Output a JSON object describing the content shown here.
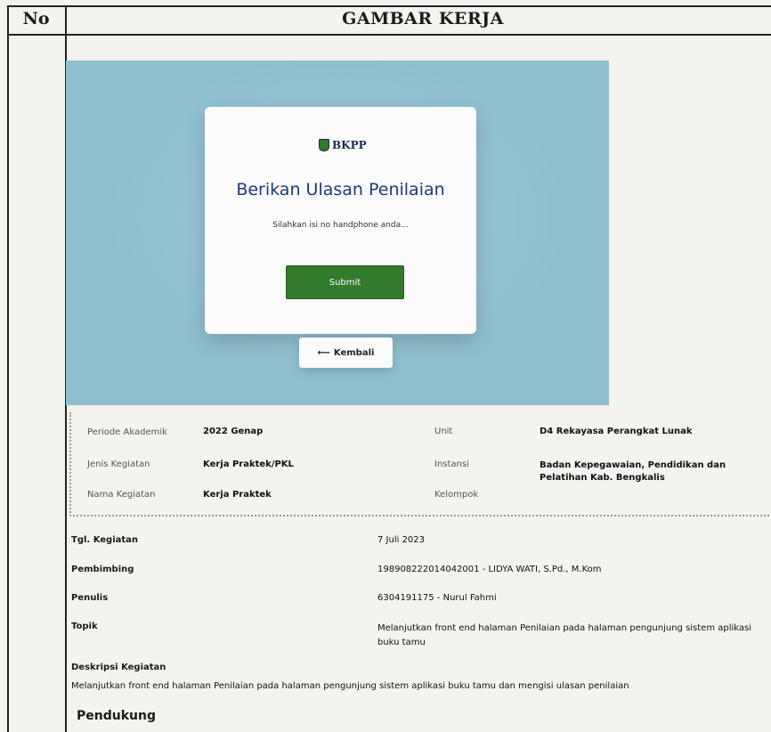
{
  "table": {
    "no_header": "No",
    "title_header": "GAMBAR KERJA"
  },
  "screenshot": {
    "logo_text": "BKPP",
    "card_title": "Berikan Ulasan Penilaian",
    "phone_placeholder": "Silahkan isi no handphone anda...",
    "submit_label": "Submit",
    "back_label": "Kembali"
  },
  "info": {
    "periode_label": "Periode Akademik",
    "periode_value": "2022 Genap",
    "unit_label": "Unit",
    "unit_value": "D4 Rekayasa Perangkat Lunak",
    "jenis_label": "Jenis Kegiatan",
    "jenis_value": "Kerja Praktek/PKL",
    "instansi_label": "Instansi",
    "instansi_value": "Badan Kepegawaian, Pendidikan dan Pelatihan Kab. Bengkalis",
    "nama_label": "Nama Kegiatan",
    "nama_value": "Kerja Praktek",
    "kelompok_label": "Kelompok"
  },
  "details": {
    "tgl_label": "Tgl. Kegiatan",
    "tgl_value": "7 Juli 2023",
    "pembimbing_label": "Pembimbing",
    "pembimbing_value": "198908222014042001 - LIDYA WATI, S.Pd., M.Kom",
    "penulis_label": "Penulis",
    "penulis_value": "6304191175 - Nurul Fahmi",
    "topik_label": "Topik",
    "topik_value": "Melanjutkan front end halaman Penilaian pada halaman pengunjung sistem aplikasi buku tamu",
    "deskripsi_label": "Deskripsi Kegiatan",
    "deskripsi_value": "Melanjutkan front end halaman Penilaian pada halaman pengunjung sistem aplikasi buku tamu dan mengisi ulasan penilaian",
    "pendukung_label": "Pendukung"
  }
}
